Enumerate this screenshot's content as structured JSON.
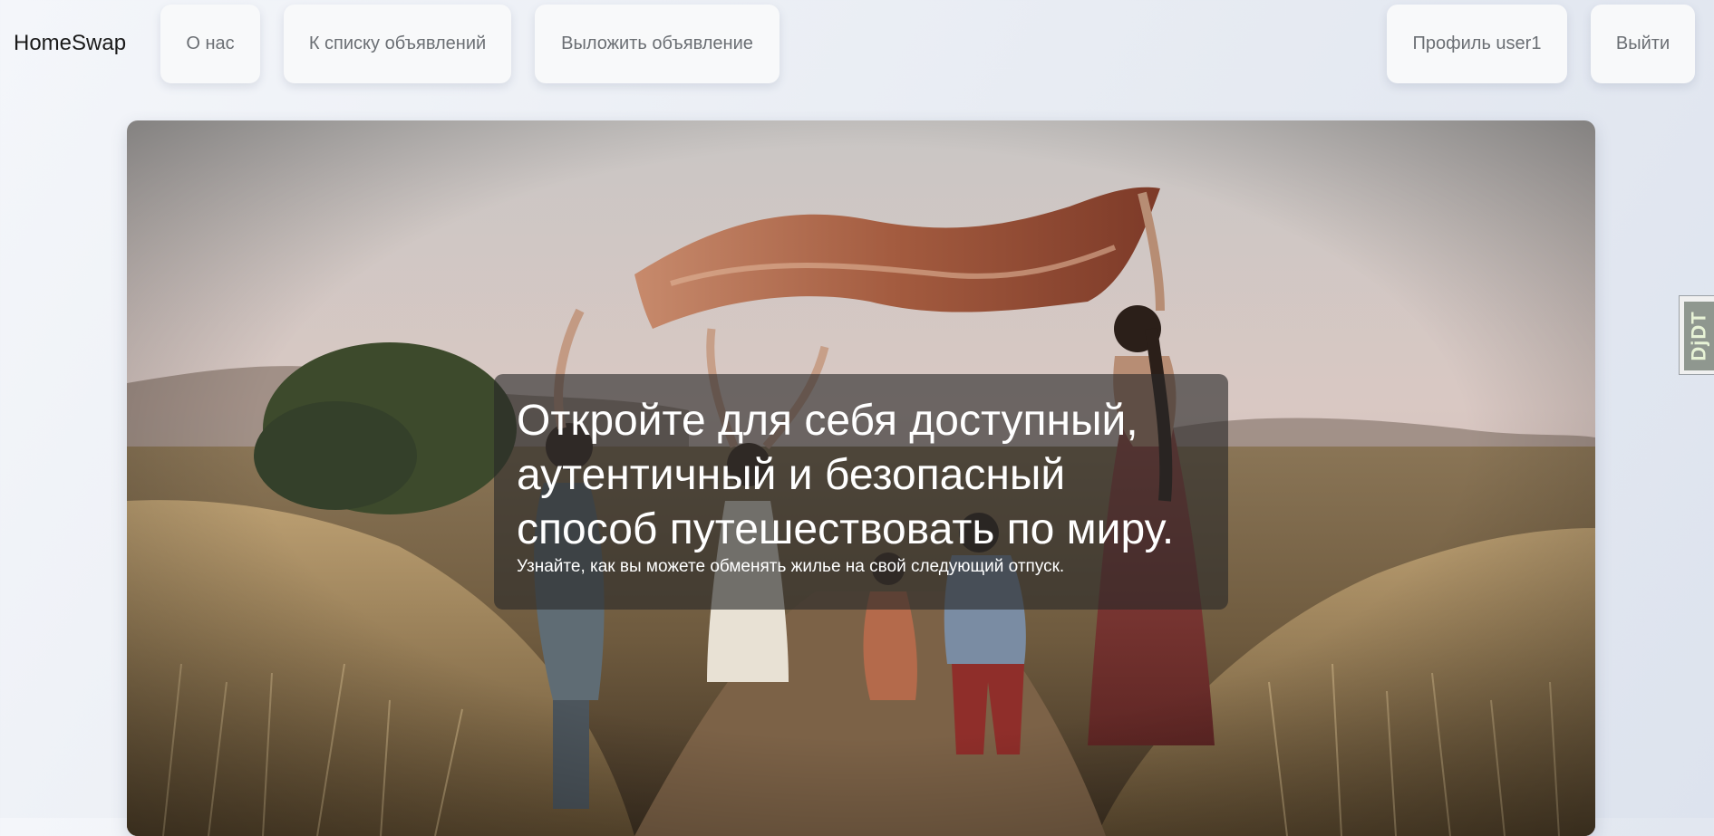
{
  "navbar": {
    "brand": "HomeSwap",
    "links": {
      "about": "О нас",
      "listings": "К списку объявлений",
      "post": "Выложить объявление",
      "profile": "Профиль user1",
      "logout": "Выйти"
    }
  },
  "hero": {
    "title": "Откройте для себя доступный, аутентичный и безопасный способ путешествовать по миру.",
    "subtitle": "Узнайте, как вы можете обменять жилье на свой следующий отпуск."
  },
  "debug_toolbar": {
    "label": "DjDT"
  }
}
